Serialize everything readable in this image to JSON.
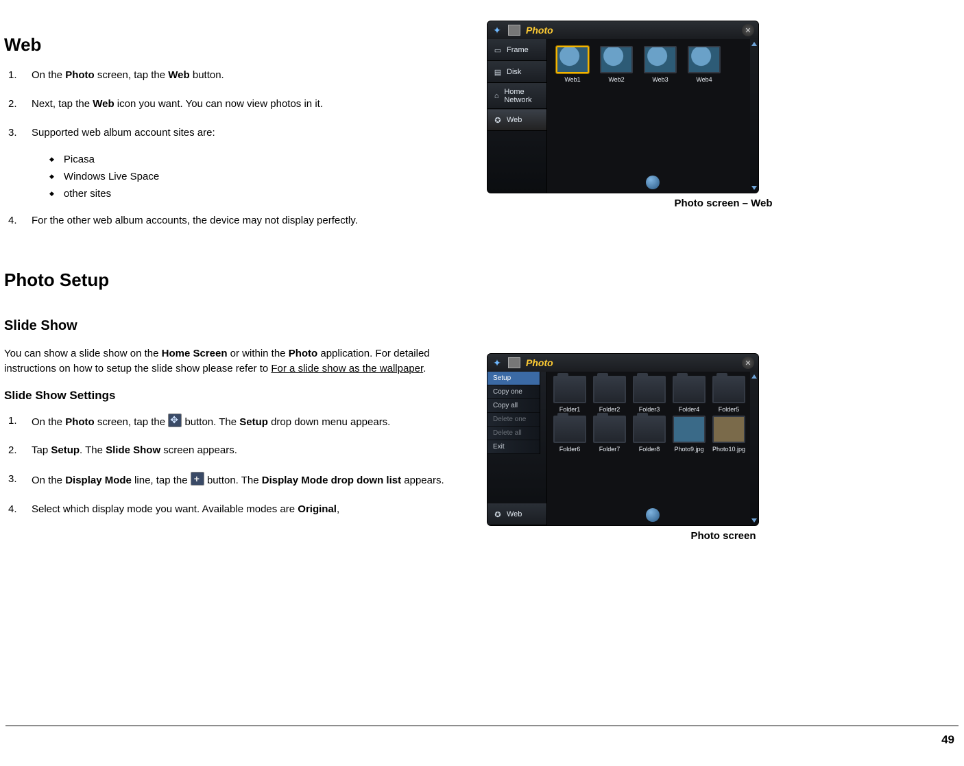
{
  "page_number": "49",
  "sections": {
    "web": {
      "heading": "Web",
      "steps": {
        "s1_pre": "On the ",
        "s1_b1": "Photo",
        "s1_mid": " screen, tap the ",
        "s1_b2": "Web",
        "s1_post": " button.",
        "s2_pre": "Next, tap the ",
        "s2_b1": "Web",
        "s2_post": " icon you want.  You can now view photos in it.",
        "s3": "Supported web album account sites are:",
        "s4": "For the other web album accounts, the device may not display perfectly."
      },
      "sub_items": [
        "Picasa",
        "Windows Live Space",
        "other sites"
      ]
    },
    "photo_setup": {
      "heading": "Photo Setup"
    },
    "slide_show": {
      "heading": "Slide Show",
      "para_pre": "You can show a slide show on the ",
      "para_b1": "Home Screen",
      "para_mid": " or within the ",
      "para_b2": "Photo",
      "para_mid2": " application.  For detailed instructions on how to setup the slide show please refer to ",
      "para_u": "For a slide show as the wallpaper",
      "para_post": "."
    },
    "slide_show_settings": {
      "heading": "Slide Show Settings",
      "s1_pre": "On the ",
      "s1_b1": "Photo",
      "s1_mid": " screen, tap the ",
      "s1_post": " button.  The ",
      "s1_b2": "Setup",
      "s1_end": " drop down menu appears.",
      "s2_pre": "Tap ",
      "s2_b1": "Setup",
      "s2_mid": ".  The ",
      "s2_b2": "Slide Show",
      "s2_post": " screen appears.",
      "s3_pre": "On the ",
      "s3_b1": "Display Mode",
      "s3_mid": " line, tap the ",
      "s3_post": " button.  The ",
      "s3_b2": "Display Mode drop down list",
      "s3_end": " appears.",
      "s4_pre": "Select which display mode you want.  Available modes are ",
      "s4_b1": "Original",
      "s4_post": ","
    }
  },
  "figures": {
    "fig1": {
      "caption": "Photo screen – Web",
      "title": "Photo",
      "sidebar": [
        "Frame",
        "Disk",
        "Home Network",
        "Web"
      ],
      "thumbs": [
        "Web1",
        "Web2",
        "Web3",
        "Web4"
      ],
      "thumb_selected_index": 0
    },
    "fig2": {
      "caption": "Photo screen",
      "title": "Photo",
      "sidebar_visible": "Web",
      "menu": {
        "items": [
          "Setup",
          "Copy one",
          "Copy all",
          "Delete one",
          "Delete all",
          "Exit"
        ],
        "selected_index": 0,
        "disabled_indices": [
          3,
          4
        ]
      },
      "thumbs": [
        "Folder1",
        "Folder2",
        "Folder3",
        "Folder4",
        "Folder5",
        "Folder6",
        "Folder7",
        "Folder8",
        "Photo9.jpg",
        "Photo10.jpg"
      ]
    }
  }
}
